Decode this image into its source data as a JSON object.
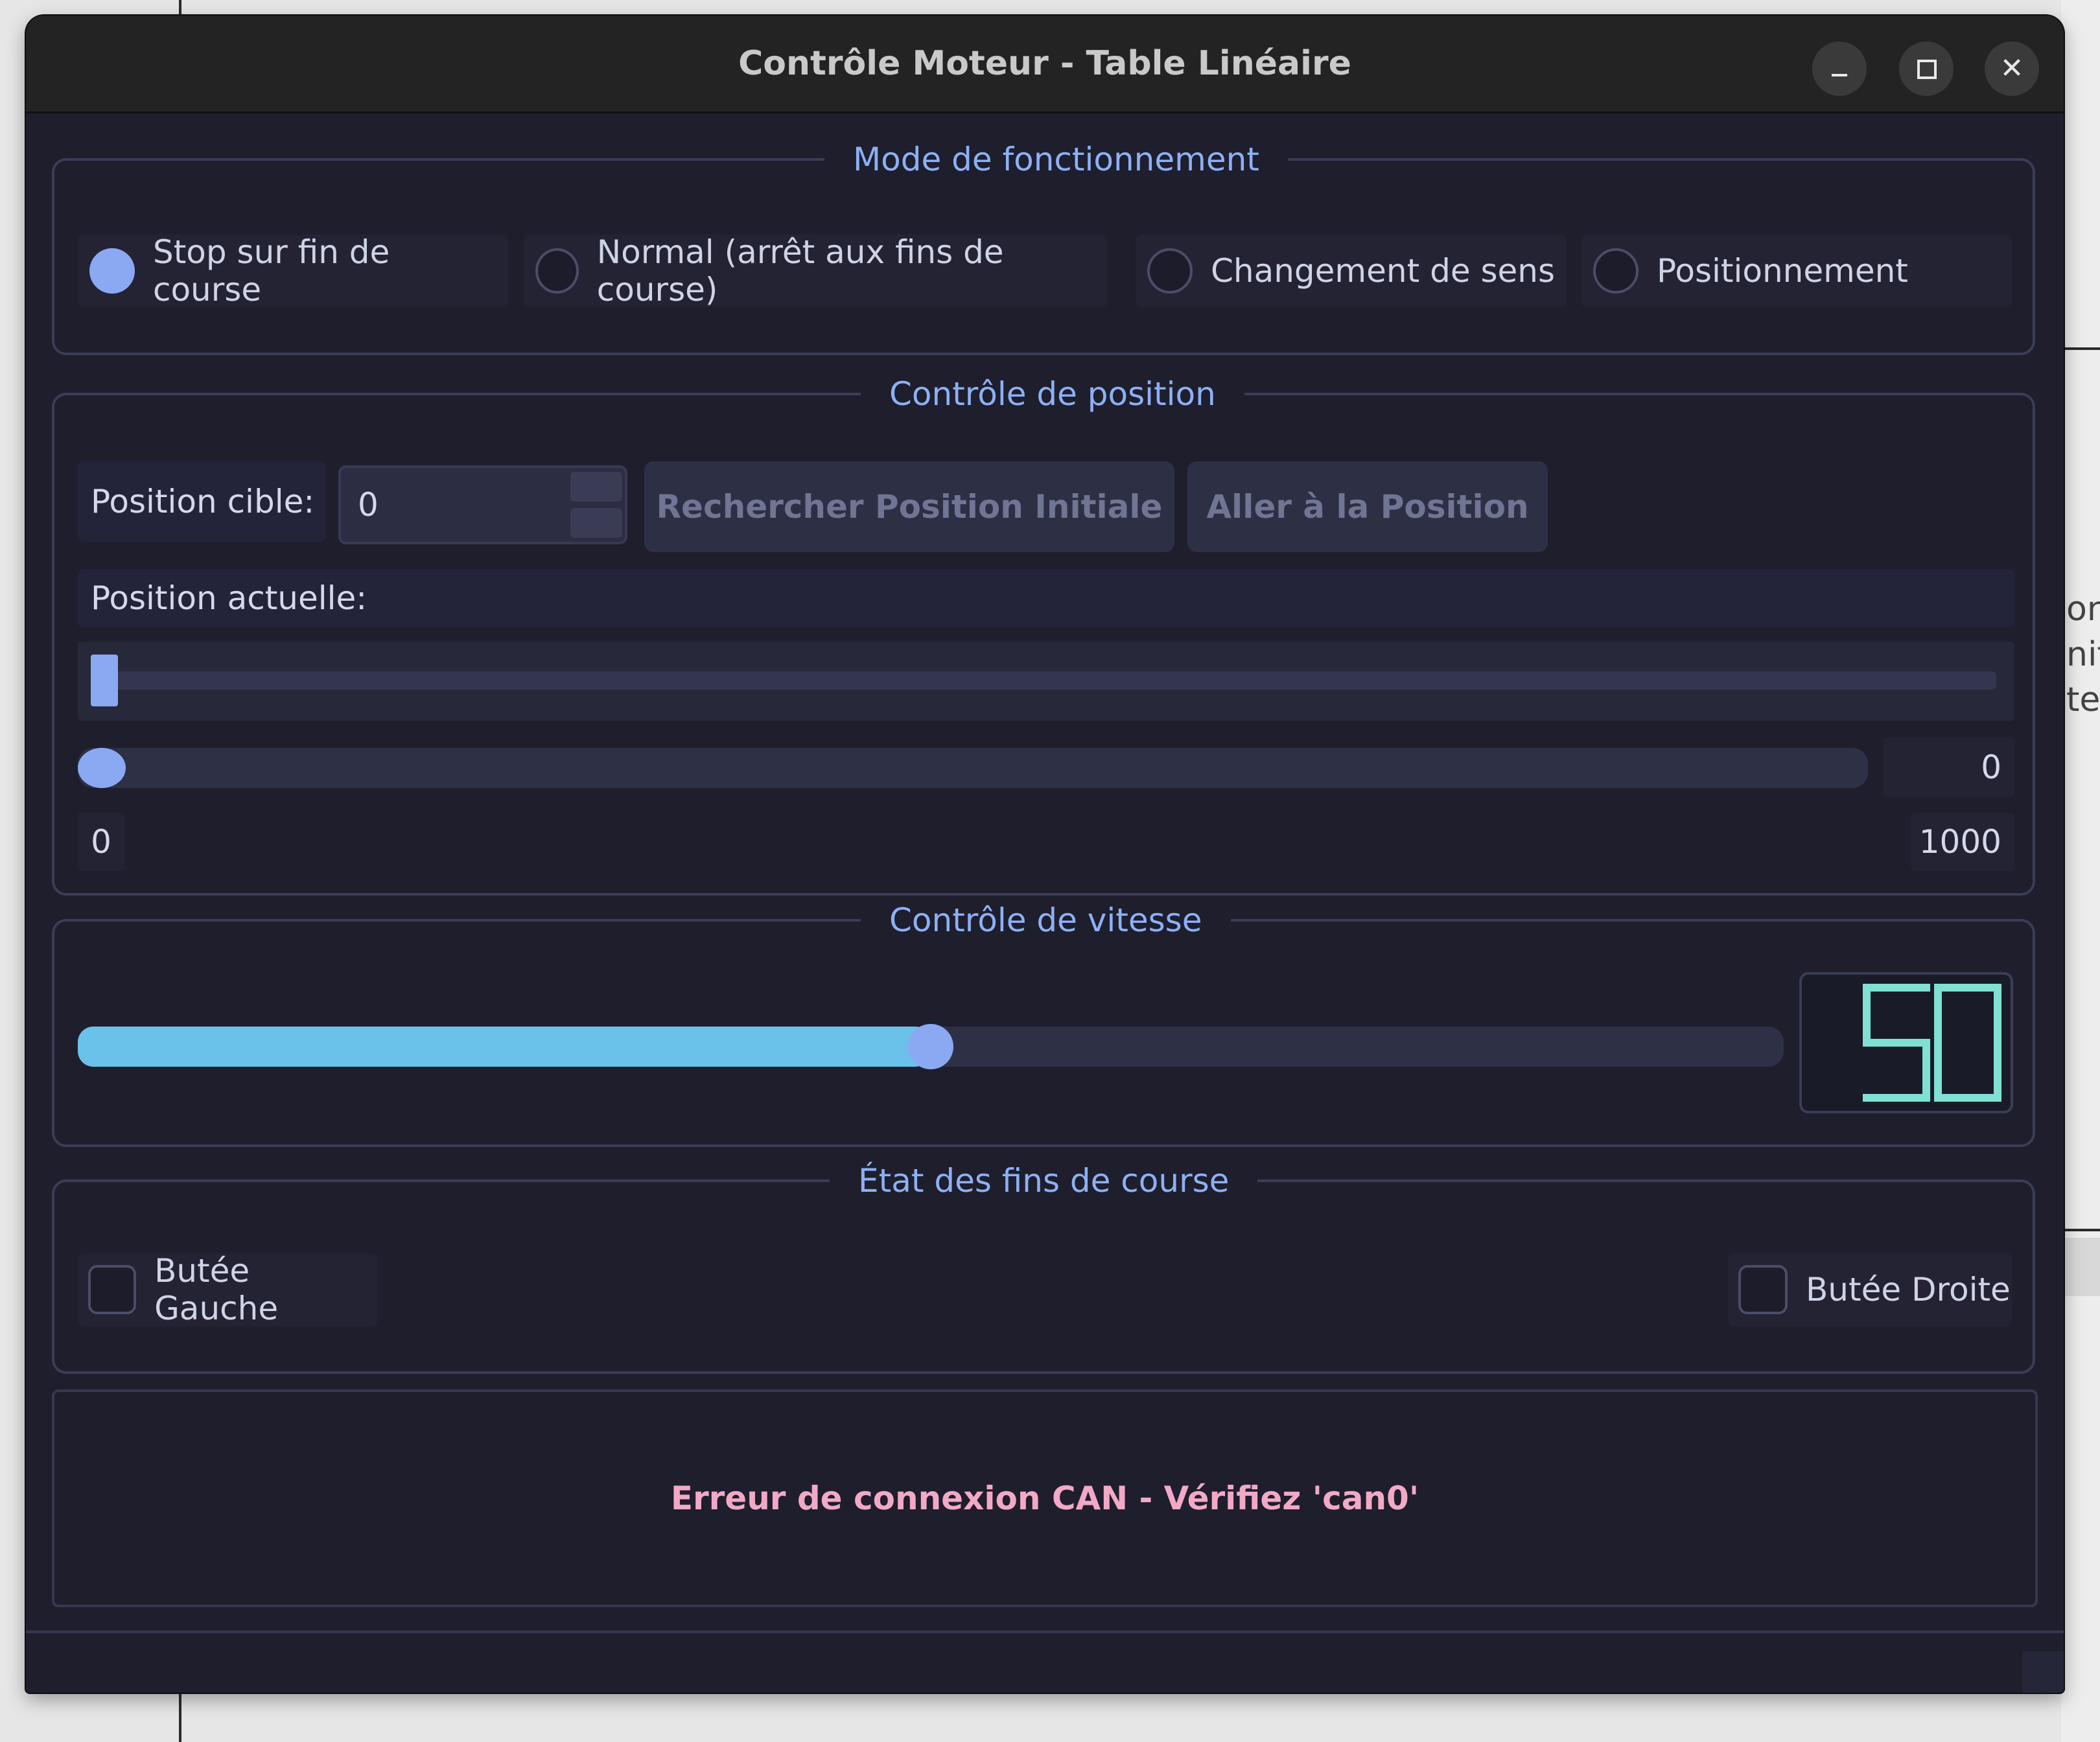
{
  "window": {
    "title": "Contrôle Moteur - Table Linéaire",
    "controls": {
      "minimize": "–",
      "maximize": "□",
      "close": "✕"
    }
  },
  "mode_group": {
    "title": "Mode de fonctionnement",
    "options": [
      {
        "label": "Stop sur fin de course",
        "selected": true
      },
      {
        "label": "Normal (arrêt aux fins de course)",
        "selected": false
      },
      {
        "label": "Changement de sens",
        "selected": false
      },
      {
        "label": "Positionnement",
        "selected": false
      }
    ]
  },
  "position_group": {
    "title": "Contrôle de position",
    "target_label": "Position cible:",
    "target_value": "0",
    "home_button": "Rechercher Position Initiale",
    "goto_button": "Aller à la Position",
    "current_label": "Position actuelle:",
    "progress_fraction": 0.0,
    "slider_value": "0",
    "range_min": "0",
    "range_max": "1000"
  },
  "speed_group": {
    "title": "Contrôle de vitesse",
    "slider_fraction": 0.5,
    "lcd_value": "50",
    "lcd_color": "#7fe0d3",
    "fill_color": "#6ac1ea"
  },
  "limits_group": {
    "title": "État des fins de course",
    "left_label": "Butée Gauche",
    "right_label": "Butée Droite",
    "left_checked": false,
    "right_checked": false
  },
  "status": {
    "message": "Erreur de connexion CAN - Vérifiez 'can0'",
    "color": "#f2a9c6"
  },
  "background_fragments": [
    "on",
    "nit",
    "te"
  ]
}
